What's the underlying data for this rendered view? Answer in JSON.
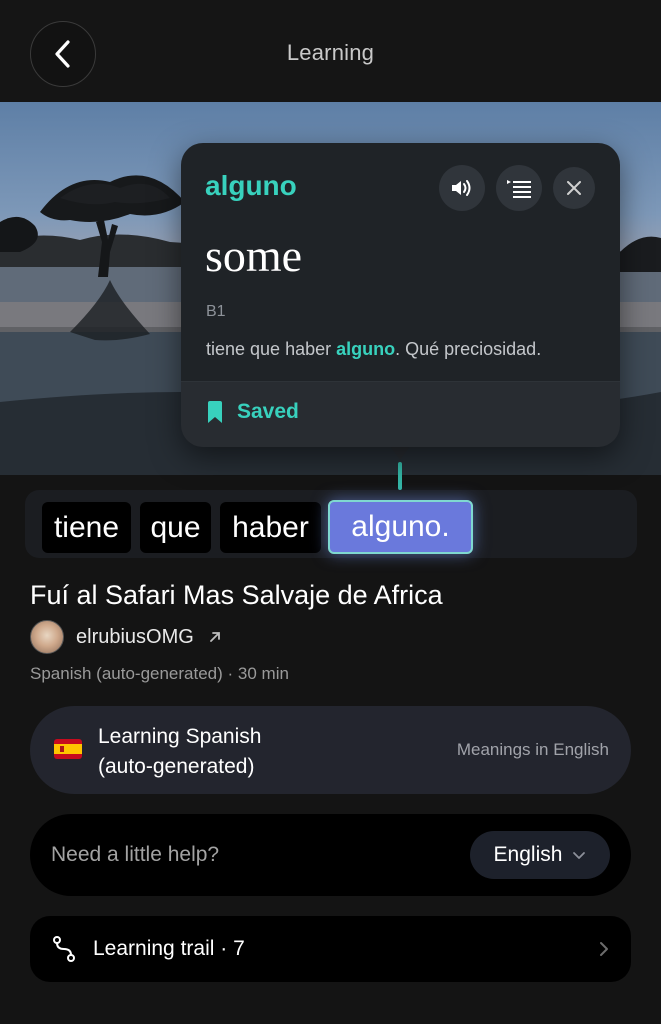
{
  "header": {
    "title": "Learning"
  },
  "popup": {
    "word": "alguno",
    "translation": "some",
    "level": "B1",
    "sentence_before": "tiene que haber ",
    "sentence_highlight": "alguno",
    "sentence_after": ". Qué preciosidad.",
    "saved_label": "Saved",
    "accent_color": "#38d1bd"
  },
  "subtitle": {
    "words": [
      "tiene",
      "que",
      "haber",
      "alguno."
    ],
    "active_index": 3
  },
  "video": {
    "title": "Fuí al Safari Mas Salvaje de Africa",
    "channel": "elrubiusOMG",
    "meta": "Spanish (auto-generated) · 30 min"
  },
  "learning_card": {
    "flag": "spain-flag",
    "line1": "Learning Spanish",
    "line2": "(auto-generated)",
    "meanings": "Meanings in English"
  },
  "help": {
    "placeholder": "Need a little help?",
    "language": "English"
  },
  "trail": {
    "label": "Learning trail · 7"
  }
}
